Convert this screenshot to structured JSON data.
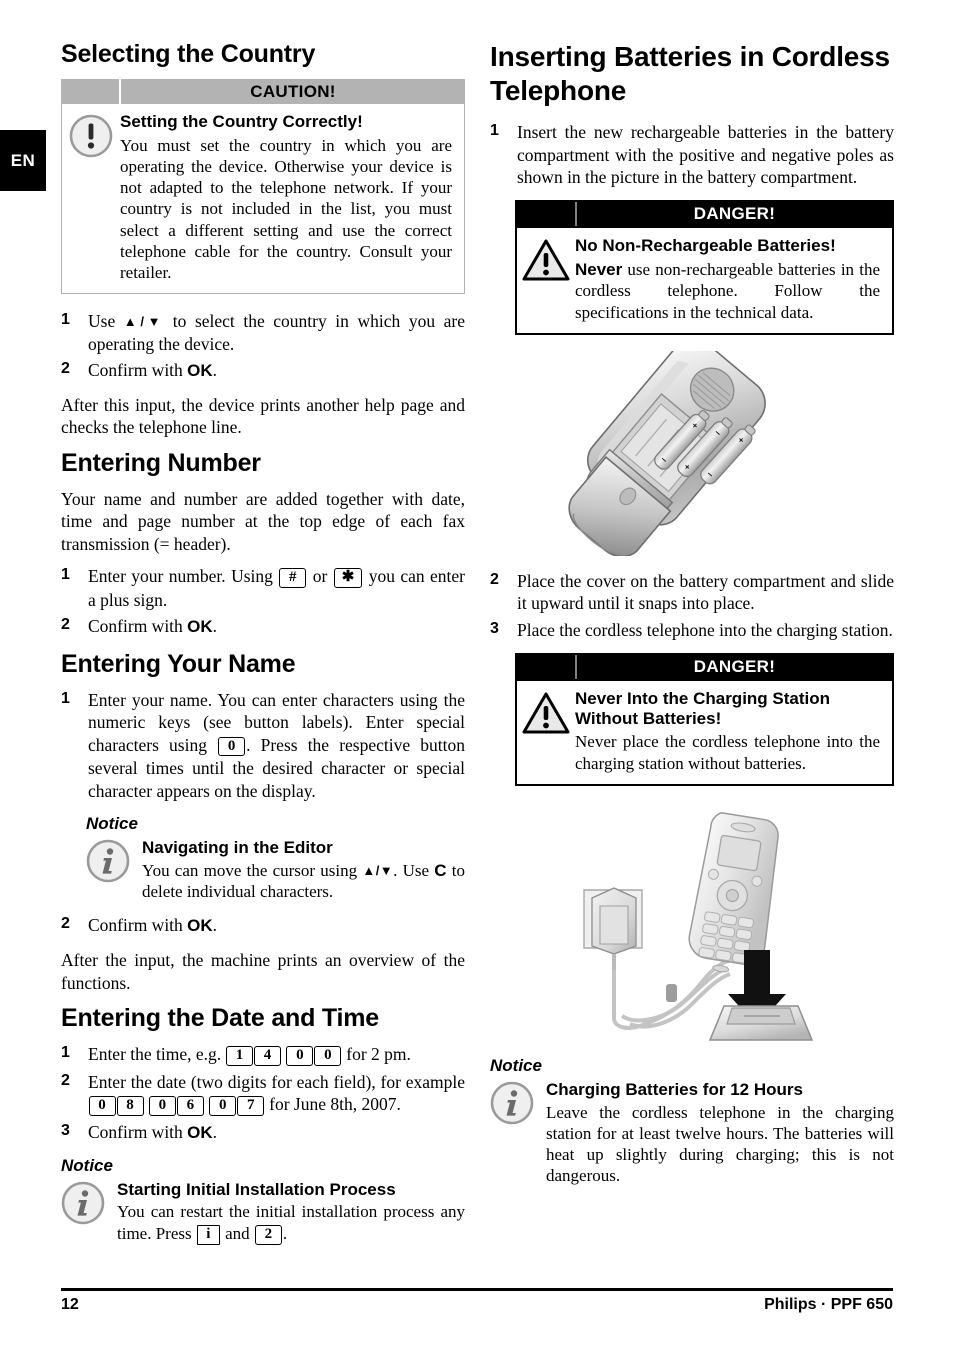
{
  "language_tab": "EN",
  "footer": {
    "page_number": "12",
    "brand_model": "Philips · PPF 650"
  },
  "left_column": {
    "section_country": {
      "heading": "Selecting the Country",
      "caution_box": {
        "header_label": "CAUTION!",
        "icon": "exclamation-circle-icon",
        "title": "Setting the Country Correctly!",
        "text": "You must set the country in which you are operating the device. Otherwise your device is not adapted to the telephone network. If your country is not included in the list, you must select a different setting and use the correct telephone cable for the country. Consult your retailer."
      },
      "steps": [
        {
          "num": "1",
          "text_before": "Use ",
          "keys": "▲/▼",
          "text_after": " to select the country in which you are operating the device."
        },
        {
          "num": "2",
          "text_before": "Confirm with ",
          "bold": "OK",
          "text_after": "."
        }
      ],
      "after_text": "After this input, the device prints another help page and checks the telephone line."
    },
    "section_number": {
      "heading": "Entering Number",
      "intro": "Your name and number are added together with date, time and page number at the top edge of each fax transmission (= header).",
      "step1_a": "Enter your number. Using ",
      "step1_key1": "#",
      "step1_b": " or ",
      "step1_key2": "✱",
      "step1_c": " you can enter a plus sign.",
      "step1_num": "1",
      "step2_num": "2",
      "step2_a": "Confirm with ",
      "step2_bold": "OK",
      "step2_b": "."
    },
    "section_name": {
      "heading": "Entering Your Name",
      "step1_num": "1",
      "step1_a": "Enter your name. You can enter characters using the numeric keys (see button labels).  Enter special characters using ",
      "step1_key": "0",
      "step1_b": ". Press the respective button several times until the desired character or special character appears on the display.",
      "notice_label": "Notice",
      "notice_icon": "info-circle-icon",
      "notice_title": "Navigating in the Editor",
      "notice_a": "You can move the cursor using ",
      "notice_keys": "▲/▼",
      "notice_b": ". Use ",
      "notice_bold": "C",
      "notice_c": " to delete individual characters.",
      "step2_num": "2",
      "step2_a": "Confirm with ",
      "step2_bold": "OK",
      "step2_b": ".",
      "after_text": "After the input, the machine prints an overview of the functions."
    },
    "section_datetime": {
      "heading": "Entering the Date and Time",
      "step1_num": "1",
      "step1_a": "Enter the time, e.g. ",
      "step1_keys": [
        "1",
        "4",
        "0",
        "0"
      ],
      "step1_b": " for 2 pm.",
      "step2_num": "2",
      "step2_a": "Enter the date (two digits for each field), for example ",
      "step2_keys": [
        "0",
        "8",
        "0",
        "6",
        "0",
        "7"
      ],
      "step2_b": " for June 8th, 2007.",
      "step3_num": "3",
      "step3_a": "Confirm with ",
      "step3_bold": "OK",
      "step3_b": ".",
      "notice_label": "Notice",
      "notice_icon": "info-circle-icon",
      "notice_title": "Starting Initial Installation Process",
      "notice_a": "You can restart the initial installation process any time. Press ",
      "notice_key1": "i",
      "notice_b": " and ",
      "notice_key2": "2",
      "notice_c": "."
    }
  },
  "right_column": {
    "heading": "Inserting Batteries in Cordless Telephone",
    "step1_num": "1",
    "step1_text": "Insert the new rechargeable batteries in the battery compartment with the positive and negative poles as shown in the picture in the battery compartment.",
    "danger_box_1": {
      "header_label": "DANGER!",
      "icon": "warning-triangle-icon",
      "title": "No Non-Rechargeable Batteries!",
      "text_bold": "Never",
      "text": " use non-rechargeable batteries in the cordless telephone. Follow the specifications in the technical data."
    },
    "figure_1": "cordless-phone-battery-compartment-illustration",
    "step2_num": "2",
    "step2_text": "Place the cover on the battery compartment and slide it upward until it snaps into place.",
    "step3_num": "3",
    "step3_text": "Place the cordless telephone into the charging station.",
    "danger_box_2": {
      "header_label": "DANGER!",
      "icon": "warning-triangle-icon",
      "title": "Never Into the Charging Station Without Batteries!",
      "text": "Never place the cordless telephone into the charging station without batteries."
    },
    "figure_2": "charging-station-with-power-adapter-illustration",
    "notice_label": "Notice",
    "notice_icon": "info-circle-icon",
    "notice_title": "Charging Batteries for 12 Hours",
    "notice_text": "Leave the cordless telephone in the charging station for at least twelve hours. The batteries will heat up slightly during charging; this is not dangerous."
  },
  "colors": {
    "caution_header_bg": "#b3b3b3",
    "danger_header_bg": "#000000",
    "icon_gray": "#9a9a9a",
    "icon_fill": "#eeeeee"
  }
}
